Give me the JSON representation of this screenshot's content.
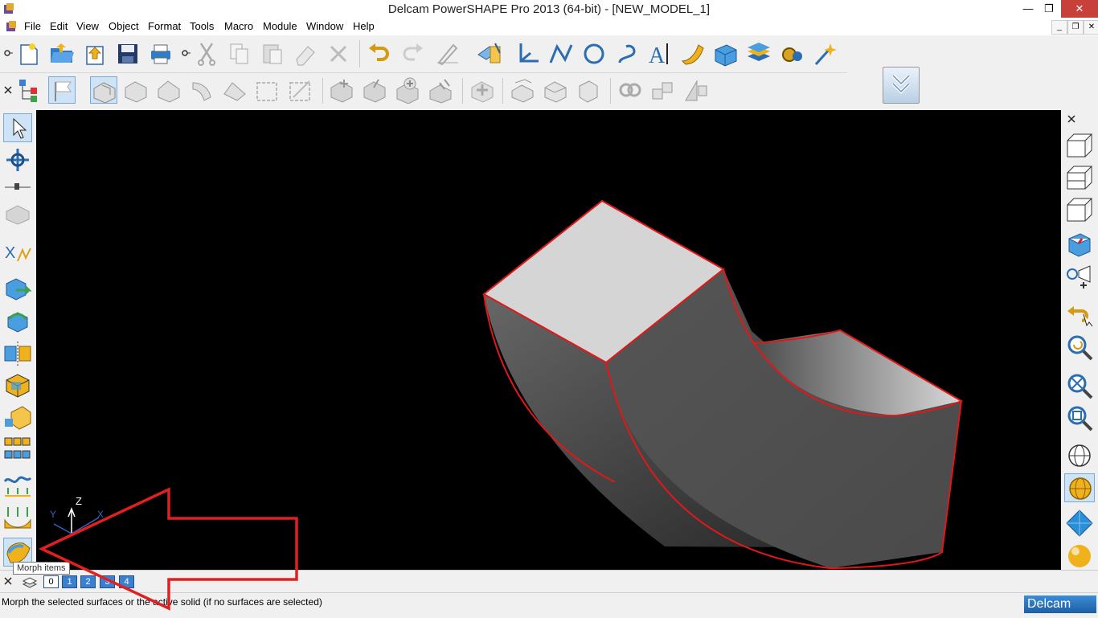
{
  "window": {
    "title": "Delcam PowerSHAPE Pro 2013 (64-bit) - [NEW_MODEL_1]",
    "controls": [
      "—",
      "❐",
      "✕"
    ]
  },
  "menu": {
    "items": [
      "File",
      "Edit",
      "View",
      "Object",
      "Format",
      "Tools",
      "Macro",
      "Module",
      "Window",
      "Help"
    ],
    "mdi_controls": [
      "_",
      "❐",
      "✕"
    ]
  },
  "toolbar_main": {
    "icons": [
      "pin-icon",
      "new-file-icon",
      "open-folder-icon",
      "import-icon",
      "save-icon",
      "print-icon",
      "pin-icon",
      "cut-icon",
      "copy-icon",
      "paste-icon",
      "eraser-icon",
      "delete-icon",
      "undo-icon",
      "redo-icon",
      "edit-pen-icon",
      "surfaces-icon",
      "workplane-icon",
      "line-icon",
      "circle-icon",
      "curve-icon",
      "text-icon",
      "surface-patch-icon",
      "solid-box-icon",
      "solid-layers-icon",
      "feature-gear-icon",
      "wizard-icon"
    ]
  },
  "toolbar_solid": {
    "icons": [
      "close-icon",
      "tree-icon",
      "flag-icon",
      "solid-icon",
      "solid-cut-icon",
      "solid-fillet-icon",
      "solid-chamfer-icon",
      "solid-shell-icon",
      "solid-draft-icon",
      "solid-offset-icon",
      "solid-boolean-add-icon",
      "solid-boolean-sub-icon",
      "solid-boolean-plus-icon",
      "solid-pattern-icon",
      "solid-plus-icon",
      "solid-split-icon",
      "solid-extrude-icon",
      "solid-cap-icon",
      "solid-replace-icon",
      "solid-group-icon",
      "solid-feature-icon"
    ]
  },
  "left_toolbar": {
    "icons": [
      "select-arrow-icon",
      "transform-icon",
      "pin-icon",
      "solid-block-icon",
      "xy-curve-icon",
      "export-icon",
      "rotate-icon",
      "mirror-icon",
      "box-icon",
      "yellow-box-icon",
      "blocks-grid-icon",
      "wave-icon",
      "projection-icon",
      "morph-icon"
    ]
  },
  "right_toolbar": {
    "icons": [
      "close-icon",
      "view-iso-icon",
      "view-front-icon",
      "view-top-icon",
      "view-red-cube-icon",
      "camera-view-icon",
      "undo-view-icon",
      "zoom-refresh-icon",
      "zoom-fit-icon",
      "zoom-box-icon",
      "wireframe-globe-icon",
      "shaded-sphere-icon",
      "diamond-view-icon",
      "gold-sphere-icon"
    ]
  },
  "viewport": {
    "axis_labels": {
      "z": "Z",
      "y": "Y",
      "x": "X"
    },
    "model_edge_color": "#e01818",
    "annotation_arrow_color": "#e02020",
    "background": "#000000"
  },
  "levelbar": {
    "levels": [
      "0",
      "1",
      "2",
      "3",
      "4"
    ],
    "tooltip": "Morph items"
  },
  "status": {
    "text": "Morph the selected surfaces or the active solid (if no surfaces are selected)",
    "brand": "Delcam"
  }
}
